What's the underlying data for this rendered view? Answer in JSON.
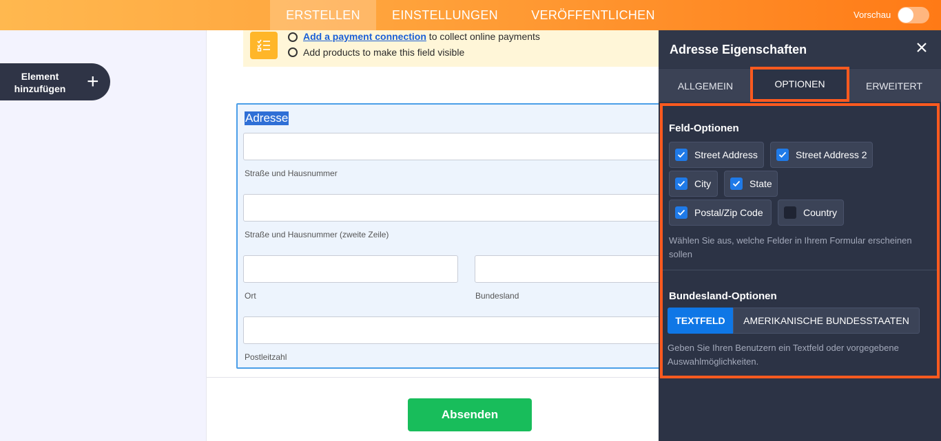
{
  "topbar": {
    "tabs": [
      {
        "label": "ERSTELLEN",
        "active": true
      },
      {
        "label": "EINSTELLUNGEN",
        "active": false
      },
      {
        "label": "VERÖFFENTLICHEN",
        "active": false
      }
    ],
    "preview_label": "Vorschau",
    "preview_on": false
  },
  "sidebar": {
    "add_element_label_1": "Element",
    "add_element_label_2": "hinzufügen",
    "add_icon": "plus-icon"
  },
  "notice": {
    "icon": "checklist-icon",
    "line1_link": "Add a payment connection",
    "line1_rest": " to collect online payments",
    "line2": "Add products to make this field visible"
  },
  "address_field": {
    "title": "Adresse",
    "street_label": "Straße und Hausnummer",
    "street2_label": "Straße und Hausnummer (zweite Zeile)",
    "city_label": "Ort",
    "state_label": "Bundesland",
    "zip_label": "Postleitzahl"
  },
  "submit_label": "Absenden",
  "panel": {
    "title": "Adresse Eigenschaften",
    "tabs": [
      {
        "label": "ALLGEMEIN",
        "active": false
      },
      {
        "label": "OPTIONEN",
        "active": true
      },
      {
        "label": "ERWEITERT",
        "active": false
      }
    ],
    "field_options_title": "Feld-Optionen",
    "field_options": [
      {
        "label": "Street Address",
        "checked": true
      },
      {
        "label": "Street Address 2",
        "checked": true
      },
      {
        "label": "City",
        "checked": true
      },
      {
        "label": "State",
        "checked": true
      },
      {
        "label": "Postal/Zip Code",
        "checked": true
      },
      {
        "label": "Country",
        "checked": false
      }
    ],
    "field_options_hint": "Wählen Sie aus, welche Felder in Ihrem Formular erscheinen sollen",
    "state_options_title": "Bundesland-Optionen",
    "state_options": [
      {
        "label": "TEXTFELD",
        "selected": true
      },
      {
        "label": "AMERIKANISCHE BUNDESSTAATEN",
        "selected": false
      }
    ],
    "state_options_hint": "Geben Sie Ihren Benutzern ein Textfeld oder vorgegebene Auswahlmöglichkeiten."
  },
  "colors": {
    "accent_orange": "#ff7a16",
    "highlight_orange": "#ff5a1f",
    "panel_bg": "#2c3345",
    "checkbox_blue": "#1f7ae8",
    "submit_green": "#18bd5b"
  }
}
